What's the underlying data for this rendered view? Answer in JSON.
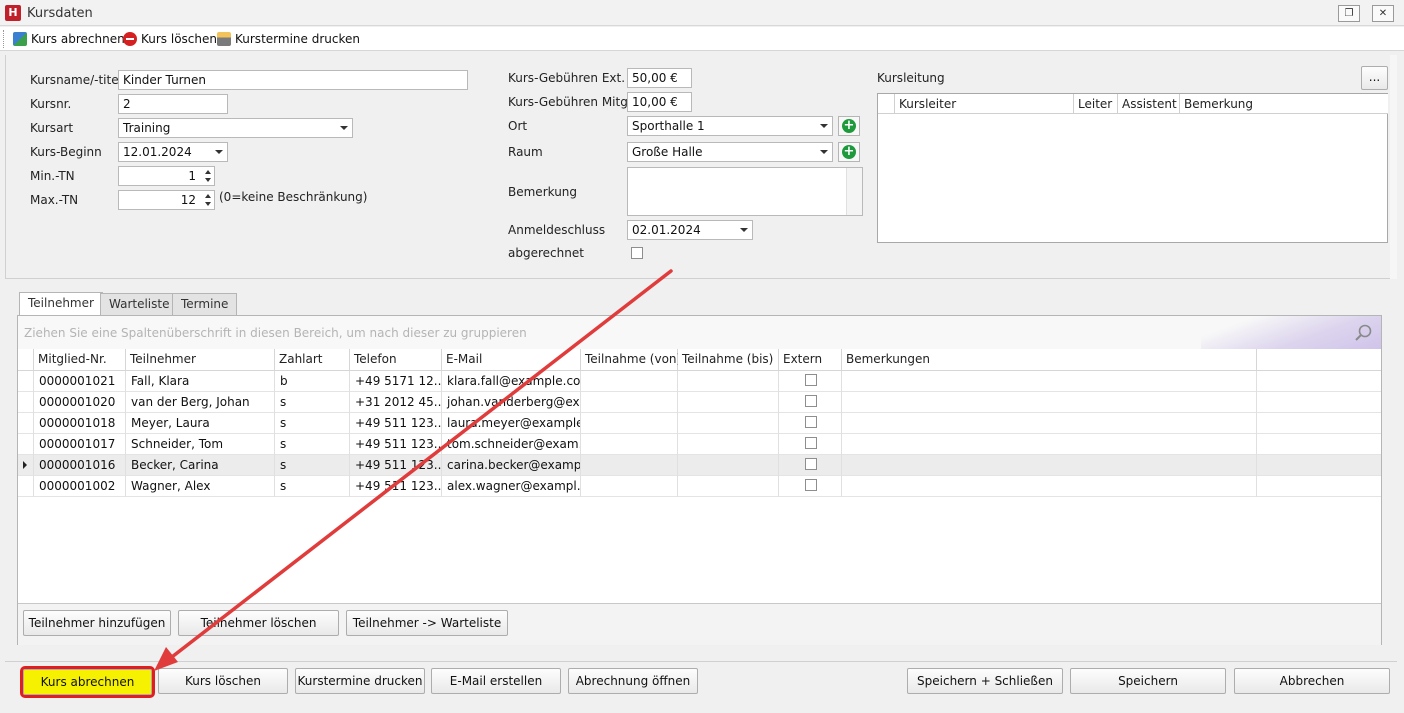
{
  "window": {
    "title": "Kursdaten",
    "icon": "app-logo-icon",
    "restore_glyph": "❐",
    "close_glyph": "✕"
  },
  "toolbar": {
    "items": [
      {
        "label": "Kurs abrechnen",
        "icon": "billing-icon"
      },
      {
        "label": "Kurs löschen",
        "icon": "delete-icon"
      },
      {
        "label": "Kurstermine drucken",
        "icon": "printer-icon"
      }
    ]
  },
  "form": {
    "kursname_label": "Kursname/-titel",
    "kursname_value": "Kinder Turnen",
    "kursnr_label": "Kursnr.",
    "kursnr_value": "2",
    "kursart_label": "Kursart",
    "kursart_value": "Training",
    "beginn_label": "Kurs-Beginn",
    "beginn_value": "12.01.2024",
    "min_label": "Min.-TN",
    "min_value": "1",
    "max_label": "Max.-TN",
    "max_value": "12",
    "max_hint": "(0=keine Beschränkung)",
    "gebuehr_ext_label": "Kurs-Gebühren Ext.",
    "gebuehr_ext_value": "50,00 €",
    "gebuehr_mitgl_label": "Kurs-Gebühren Mitgl.",
    "gebuehr_mitgl_value": "10,00 €",
    "ort_label": "Ort",
    "ort_value": "Sporthalle 1",
    "raum_label": "Raum",
    "raum_value": "Große Halle",
    "bemerkung_label": "Bemerkung",
    "bemerkung_value": "",
    "anmeldeschluss_label": "Anmeldeschluss",
    "anmeldeschluss_value": "02.01.2024",
    "abgerechnet_label": "abgerechnet",
    "abgerechnet_checked": false
  },
  "kursleitung": {
    "label": "Kursleitung",
    "more_button": "...",
    "columns": [
      "Kursleiter",
      "Leiter",
      "Assistent",
      "Bemerkung"
    ],
    "rows": []
  },
  "tabs": [
    {
      "label": "Teilnehmer",
      "active": true
    },
    {
      "label": "Warteliste",
      "active": false
    },
    {
      "label": "Termine",
      "active": false
    }
  ],
  "grid": {
    "group_hint": "Ziehen Sie eine Spaltenüberschrift in diesen Bereich, um nach dieser zu gruppieren",
    "columns": [
      "Mitglied-Nr.",
      "Teilnehmer",
      "Zahlart",
      "Telefon",
      "E-Mail",
      "Teilnahme (von)",
      "Teilnahme (bis)",
      "Extern",
      "Bemerkungen"
    ],
    "rows": [
      {
        "nr": "0000001021",
        "name": "Fall, Klara",
        "zahlart": "b",
        "telefon": "+49 5171 12...",
        "email": "klara.fall@example.com",
        "von": "",
        "bis": "",
        "extern": false,
        "bemerkung": "",
        "selected": false
      },
      {
        "nr": "0000001020",
        "name": "van der Berg, Johan",
        "zahlart": "s",
        "telefon": "+31 2012 45...",
        "email": "johan.vanderberg@ex...",
        "von": "",
        "bis": "",
        "extern": false,
        "bemerkung": "",
        "selected": false
      },
      {
        "nr": "0000001018",
        "name": "Meyer, Laura",
        "zahlart": "s",
        "telefon": "+49 511 123...",
        "email": "laura.meyer@example...",
        "von": "",
        "bis": "",
        "extern": false,
        "bemerkung": "",
        "selected": false
      },
      {
        "nr": "0000001017",
        "name": "Schneider, Tom",
        "zahlart": "s",
        "telefon": "+49 511 123...",
        "email": "tom.schneider@exam...",
        "von": "",
        "bis": "",
        "extern": false,
        "bemerkung": "",
        "selected": false
      },
      {
        "nr": "0000001016",
        "name": "Becker, Carina",
        "zahlart": "s",
        "telefon": "+49 511 123...",
        "email": "carina.becker@examp...",
        "von": "",
        "bis": "",
        "extern": false,
        "bemerkung": "",
        "selected": true
      },
      {
        "nr": "0000001002",
        "name": "Wagner, Alex",
        "zahlart": "s",
        "telefon": "+49 511 123...",
        "email": "alex.wagner@exampl...",
        "von": "",
        "bis": "",
        "extern": false,
        "bemerkung": "",
        "selected": false
      }
    ],
    "buttons": [
      "Teilnehmer hinzufügen",
      "Teilnehmer löschen",
      "Teilnehmer -> Warteliste"
    ]
  },
  "bottom_buttons": {
    "kurs_abrechnen": "Kurs abrechnen",
    "kurs_loeschen": "Kurs löschen",
    "termine_drucken": "Kurstermine drucken",
    "email": "E-Mail erstellen",
    "abrechnung": "Abrechnung öffnen",
    "speichern_schliessen": "Speichern +  Schließen",
    "speichern": "Speichern",
    "abbrechen": "Abbrechen"
  },
  "colors": {
    "highlight": "#f5f100",
    "annotation": "#e03c3c"
  }
}
